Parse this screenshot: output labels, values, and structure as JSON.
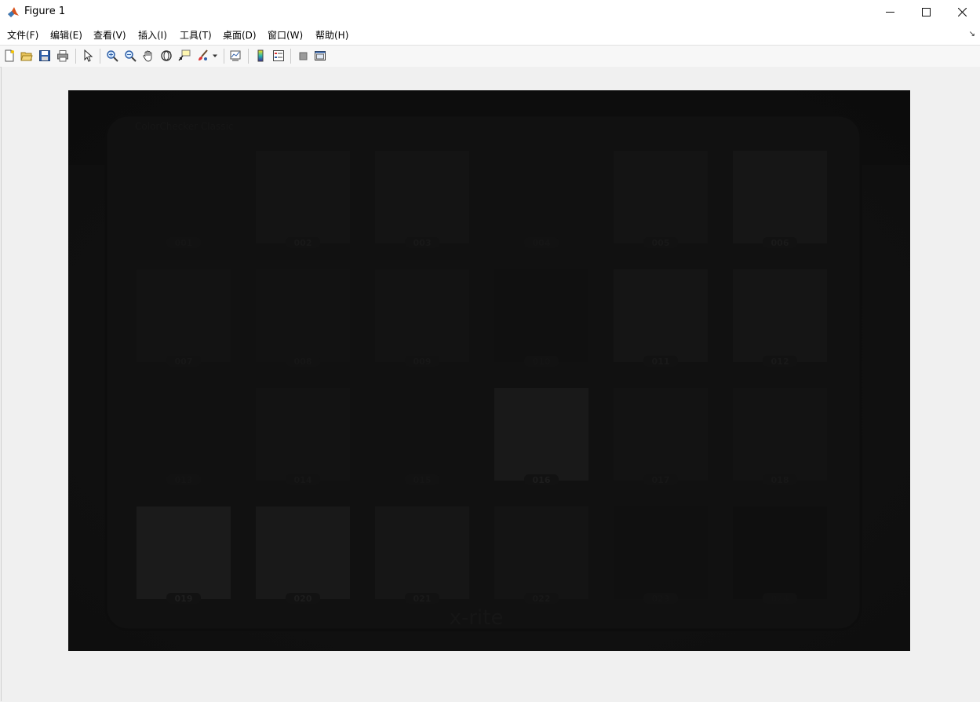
{
  "window": {
    "title": "Figure 1",
    "minimize_glyph": "—",
    "maximize_glyph": "☐",
    "close_glyph": "✕"
  },
  "menu": {
    "items": [
      "文件(F)",
      "编辑(E)",
      "查看(V)",
      "插入(I)",
      "工具(T)",
      "桌面(D)",
      "窗口(W)",
      "帮助(H)"
    ],
    "overflow_glyph": "↘"
  },
  "toolbar": {
    "buttons": [
      {
        "name": "new-figure-icon"
      },
      {
        "name": "open-file-icon"
      },
      {
        "name": "save-icon"
      },
      {
        "name": "print-icon"
      },
      {
        "name": "pointer-icon"
      },
      {
        "name": "zoom-in-icon"
      },
      {
        "name": "zoom-out-icon"
      },
      {
        "name": "pan-hand-icon"
      },
      {
        "name": "rotate-3d-icon"
      },
      {
        "name": "data-cursor-icon"
      },
      {
        "name": "brush-icon"
      },
      {
        "name": "link-plot-icon"
      },
      {
        "name": "colorbar-icon"
      },
      {
        "name": "legend-icon"
      },
      {
        "name": "hide-plot-tools-icon"
      },
      {
        "name": "show-plot-tools-icon"
      }
    ]
  },
  "image": {
    "description_colors": {
      "background": "#101010",
      "card": "#121212",
      "patch_dark": "#141414",
      "patch_light": "#1f1f1f"
    },
    "patch_labels": [
      [
        "001",
        "002",
        "003",
        "004",
        "005",
        "006"
      ],
      [
        "007",
        "008",
        "009",
        "010",
        "011",
        "012"
      ],
      [
        "013",
        "014",
        "015",
        "016",
        "017",
        "018"
      ],
      [
        "019",
        "020",
        "021",
        "022",
        "023",
        "024"
      ]
    ],
    "patch_brightness": [
      [
        0.06,
        0.12,
        0.12,
        0.05,
        0.12,
        0.16
      ],
      [
        0.1,
        0.08,
        0.1,
        0.04,
        0.14,
        0.14
      ],
      [
        0.05,
        0.09,
        0.06,
        0.22,
        0.09,
        0.1
      ],
      [
        0.26,
        0.21,
        0.16,
        0.11,
        0.03,
        0.02
      ]
    ],
    "card_caption": "ColorChecker Classic",
    "brand": "x-rite"
  }
}
